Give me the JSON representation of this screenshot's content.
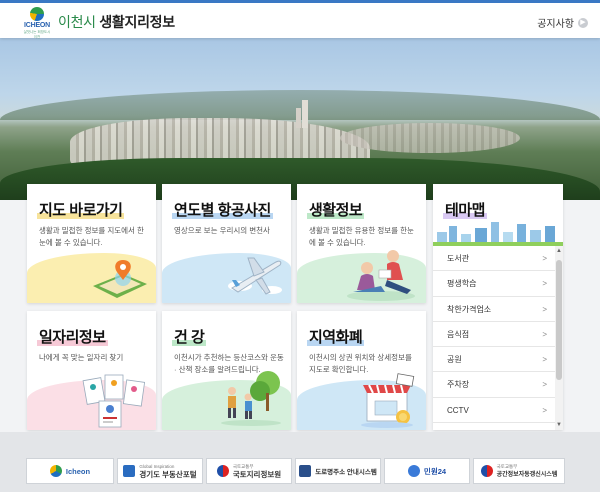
{
  "header": {
    "logo_text": "ICHEON",
    "logo_sub": "살맛나는 희망도시 이천",
    "title_city": "이천시",
    "title_main": "생활지리정보",
    "notice_label": "공지사항",
    "notice_icon": "chevron-right-icon"
  },
  "cards": [
    {
      "title": "지도 바로가기",
      "desc": "생활과 밀접한 정보를 지도에서 한눈에 볼 수 있습니다.",
      "icon": "map-pin-icon",
      "accent": "#f7e39b"
    },
    {
      "title": "연도별 항공사진",
      "desc": "영상으로 보는 우리시의 변천사",
      "icon": "airplane-icon",
      "accent": "#b9d6f2"
    },
    {
      "title": "생활정보",
      "desc": "생활과 밀접한 유용한 정보를 한눈에 볼 수 있습니다.",
      "icon": "people-reading-icon",
      "accent": "#bde8c8"
    },
    {
      "title": "일자리정보",
      "desc": "나에게 꼭 맞는 일자리 찾기",
      "icon": "job-cards-icon",
      "accent": "#f6c9d6"
    },
    {
      "title": "건 강",
      "desc": "이천시가 추천하는 등산코스와 운동 · 산책 장소를 알려드립니다.",
      "icon": "hiking-family-icon",
      "accent": "#bde8c8"
    },
    {
      "title": "지역화폐",
      "desc": "이천시의 상권 위치와 상세정보를 지도로 확인합니다.",
      "icon": "shop-icon",
      "accent": "#b9d6f2"
    }
  ],
  "theme": {
    "title": "테마맵",
    "items": [
      "도서관",
      "평생학습",
      "착한가격업소",
      "음식점",
      "공원",
      "주차장",
      "CCTV"
    ]
  },
  "footer": {
    "links": [
      {
        "label": "Icheon",
        "sub": ""
      },
      {
        "label": "경기도 부동산포털",
        "sub": "Global Inspiration"
      },
      {
        "label": "국토지리정보원",
        "sub": "국토교통부"
      },
      {
        "label": "도로명주소 안내시스템",
        "sub": "도로명주소 안내시스템"
      },
      {
        "label": "민원24",
        "sub": "민원24"
      },
      {
        "label": "공간정보자동갱신시스템",
        "sub": "국토교통부"
      }
    ]
  },
  "colors": {
    "accent_blue": "#3a78c4",
    "brand_green": "#2a8a4a"
  }
}
